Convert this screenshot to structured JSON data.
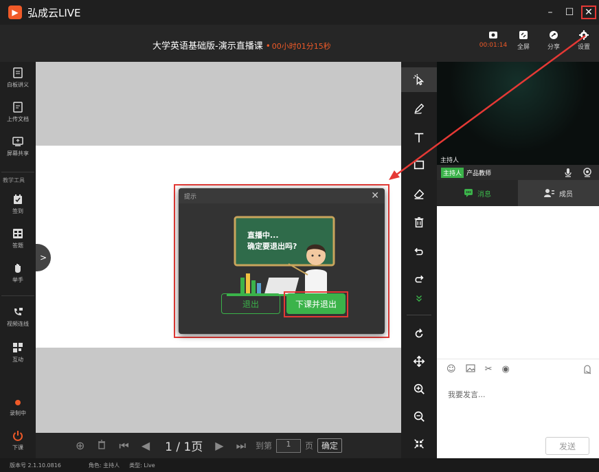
{
  "app": {
    "name": "弘成云LIVE",
    "logo_glyph": "▶"
  },
  "window_controls": {
    "minimize": "–",
    "maximize": "☐",
    "close": "✕"
  },
  "header": {
    "course_title": "大学英语基础版-演示直播课",
    "elapsed": "00小时01分15秒",
    "tools": [
      {
        "icon": "record-icon",
        "label": "00:01:14"
      },
      {
        "icon": "fullscreen-icon",
        "label": "全屏"
      },
      {
        "icon": "share-icon",
        "label": "分享"
      },
      {
        "icon": "settings-icon",
        "label": "设置"
      }
    ]
  },
  "sidebar": {
    "items": [
      {
        "icon": "whiteboard-icon",
        "label": "白板讲义"
      },
      {
        "icon": "upload-doc-icon",
        "label": "上传文档"
      },
      {
        "icon": "screen-share-icon",
        "label": "屏幕共享"
      }
    ],
    "section_label": "教学工具",
    "tools": [
      {
        "icon": "checkin-icon",
        "label": "签到"
      },
      {
        "icon": "quiz-icon",
        "label": "答题"
      },
      {
        "icon": "raise-hand-icon",
        "label": "举手"
      },
      {
        "icon": "video-link-icon",
        "label": "视频连线"
      },
      {
        "icon": "interact-icon",
        "label": "互动"
      }
    ],
    "recording_label": "录制中",
    "end_class_label": "下课",
    "expand_glyph": ">"
  },
  "bottom_bar": {
    "add_glyph": "⊕",
    "delete_glyph": "🗑",
    "first_glyph": "⏮",
    "prev_glyph": "◀",
    "page": "1 / 1页",
    "next_glyph": "▶",
    "last_glyph": "⏭",
    "goto_label": "到第",
    "page_input": "1",
    "page_unit": "页",
    "confirm": "确定"
  },
  "dialog": {
    "title": "提示",
    "close": "✕",
    "line1": "直播中...",
    "line2": "确定要退出吗?",
    "exit_button": "退出",
    "end_button": "下课并退出"
  },
  "right_panel": {
    "video_label": "主持人",
    "host_badge": "主持人",
    "host_name": "产品教师",
    "tabs": [
      {
        "icon": "message-icon",
        "label": "消息"
      },
      {
        "icon": "members-icon",
        "label": "成员"
      }
    ],
    "chat_placeholder": "我要发言...",
    "send_button": "发送"
  },
  "status_bar": {
    "version": "版本号 2.1.10.0816",
    "role": "角色: 主持人",
    "type": "类型: Live"
  },
  "colors": {
    "accent_green": "#3bb34a",
    "accent_orange": "#f05a28",
    "annotation_red": "#e53935"
  }
}
